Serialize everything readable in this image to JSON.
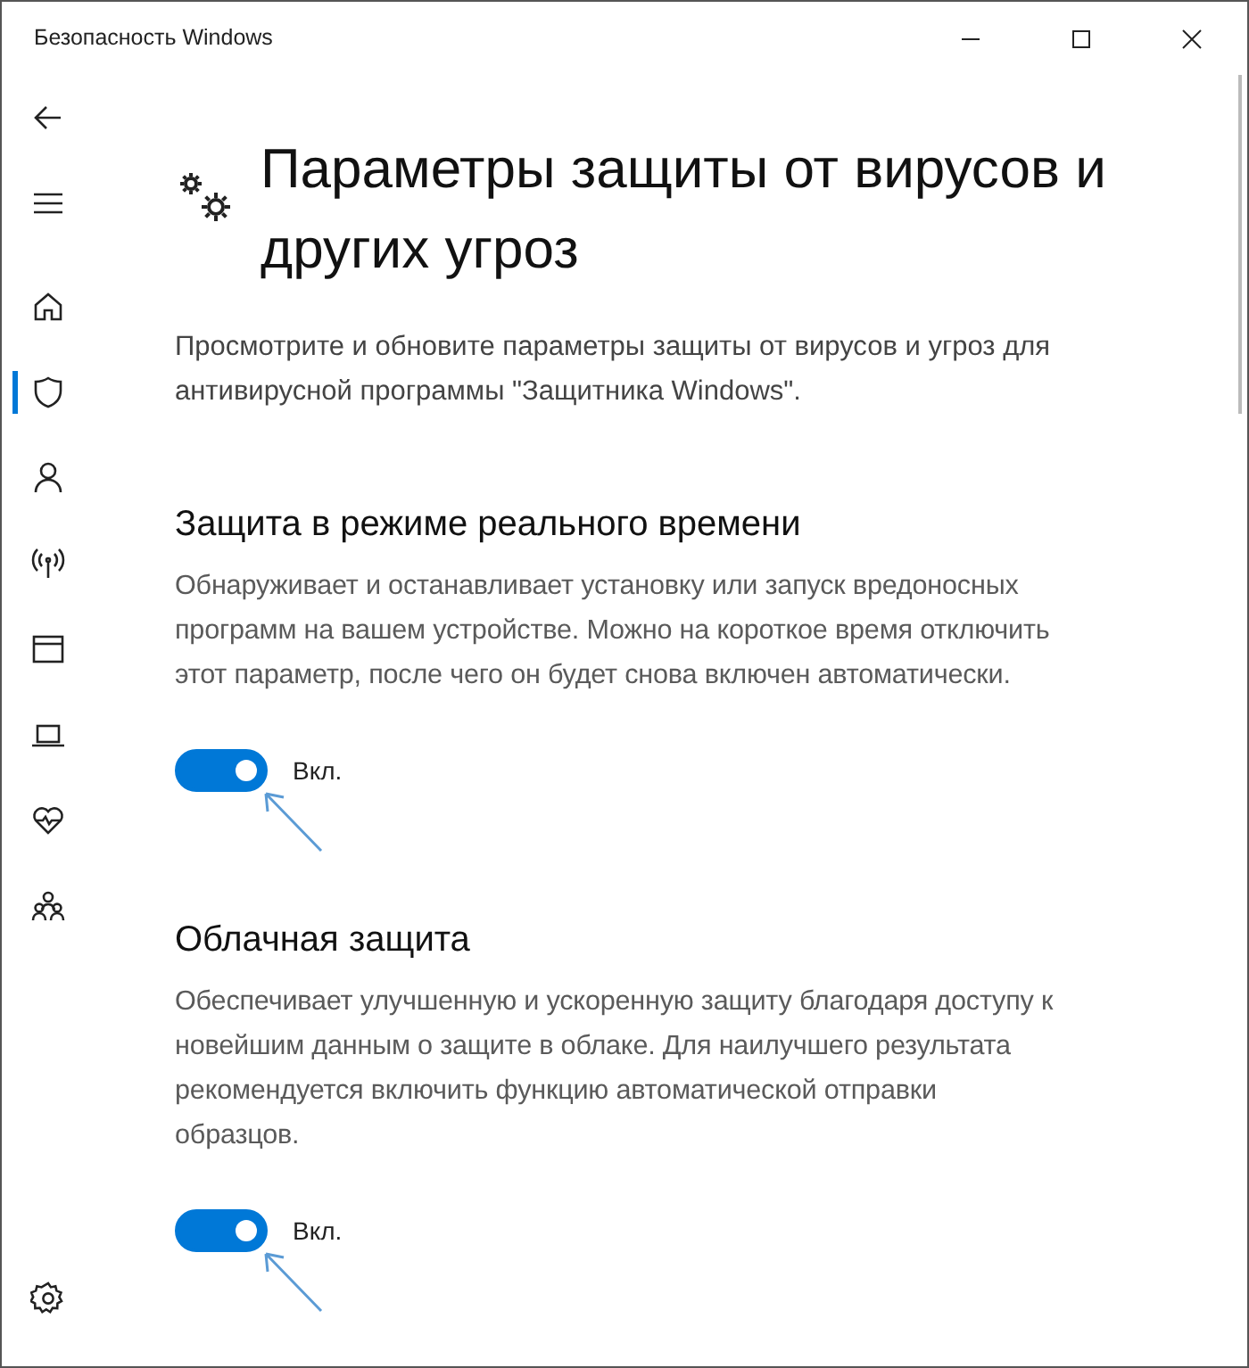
{
  "window": {
    "title": "Безопасность Windows",
    "controls": [
      {
        "kind": "minimize"
      },
      {
        "kind": "maximize"
      },
      {
        "kind": "close"
      }
    ]
  },
  "sidebar": {
    "items": [
      {
        "kind": "back",
        "selected": false
      },
      {
        "kind": "menu",
        "selected": false
      },
      {
        "kind": "home",
        "selected": false
      },
      {
        "kind": "shield",
        "selected": true
      },
      {
        "kind": "person",
        "selected": false
      },
      {
        "kind": "antenna",
        "selected": false
      },
      {
        "kind": "window",
        "selected": false
      },
      {
        "kind": "laptop",
        "selected": false
      },
      {
        "kind": "heart",
        "selected": false
      },
      {
        "kind": "family",
        "selected": false
      }
    ],
    "bottom_items": [
      {
        "kind": "settings",
        "selected": false
      }
    ]
  },
  "page": {
    "title": "Параметры защиты от вирусов и\nдругих угроз",
    "description": "Просмотрите и обновите параметры защиты от вирусов и угроз для\nантивирусной программы \"Защитника Windows\"."
  },
  "sections": [
    {
      "heading": "Защита в режиме реального времени",
      "text": "Обнаруживает и останавливает установку или запуск вредоносных\nпрограмм на вашем устройстве. Можно на короткое время отключить\nэтот параметр, после чего он будет снова включен автоматически.",
      "on": true,
      "label": "Вкл.",
      "annotation_arrow": true
    },
    {
      "heading": "Облачная защита",
      "text": "Обеспечивает улучшенную и ускоренную защиту благодаря доступу к\nновейшим данным о защите в облаке. Для наилучшего результата\nрекомендуется включить функцию автоматической отправки\nобразцов.",
      "on": true,
      "label": "Вкл.",
      "annotation_arrow": true
    }
  ]
}
